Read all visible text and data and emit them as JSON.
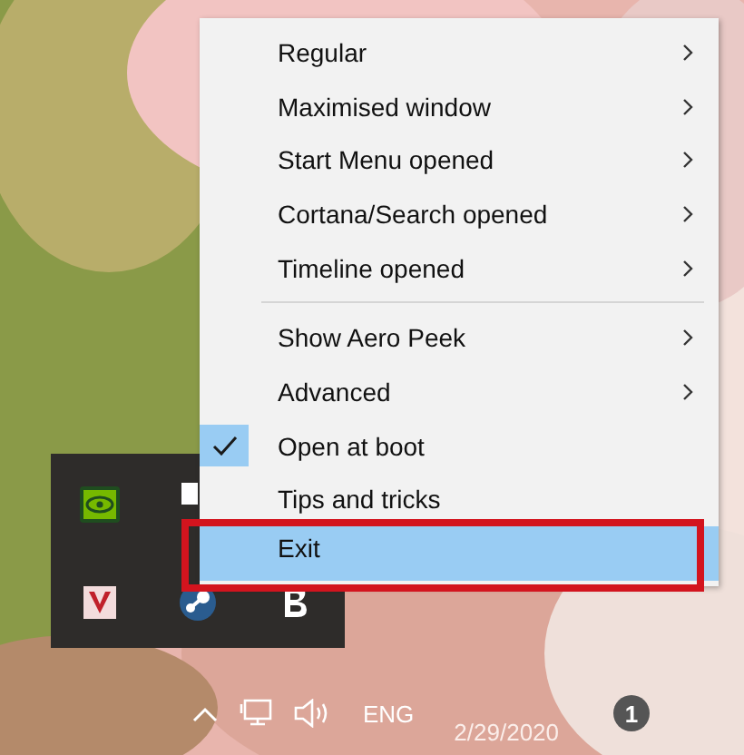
{
  "menu": {
    "items": [
      {
        "kind": "submenu",
        "label": "Regular",
        "selected": false,
        "outlined": false
      },
      {
        "kind": "submenu",
        "label": "Maximised window",
        "selected": false,
        "outlined": false
      },
      {
        "kind": "submenu",
        "label": "Start Menu opened",
        "selected": false,
        "outlined": false
      },
      {
        "kind": "submenu",
        "label": "Cortana/Search opened",
        "selected": false,
        "outlined": false
      },
      {
        "kind": "submenu",
        "label": "Timeline opened",
        "selected": false,
        "outlined": false
      },
      {
        "kind": "separator"
      },
      {
        "kind": "submenu",
        "label": "Show Aero Peek",
        "selected": false,
        "outlined": false
      },
      {
        "kind": "submenu",
        "label": "Advanced",
        "selected": false,
        "outlined": false
      },
      {
        "kind": "toggle",
        "label": "Open at boot",
        "checked": true,
        "selected": false,
        "outlined": false
      },
      {
        "kind": "command",
        "label": "Tips and tricks",
        "selected": false,
        "outlined": false
      },
      {
        "kind": "command",
        "label": "Exit",
        "selected": true,
        "outlined": true
      }
    ]
  },
  "taskbar": {
    "language": "ENG",
    "date": "2/29/2020",
    "notifications": "1"
  }
}
